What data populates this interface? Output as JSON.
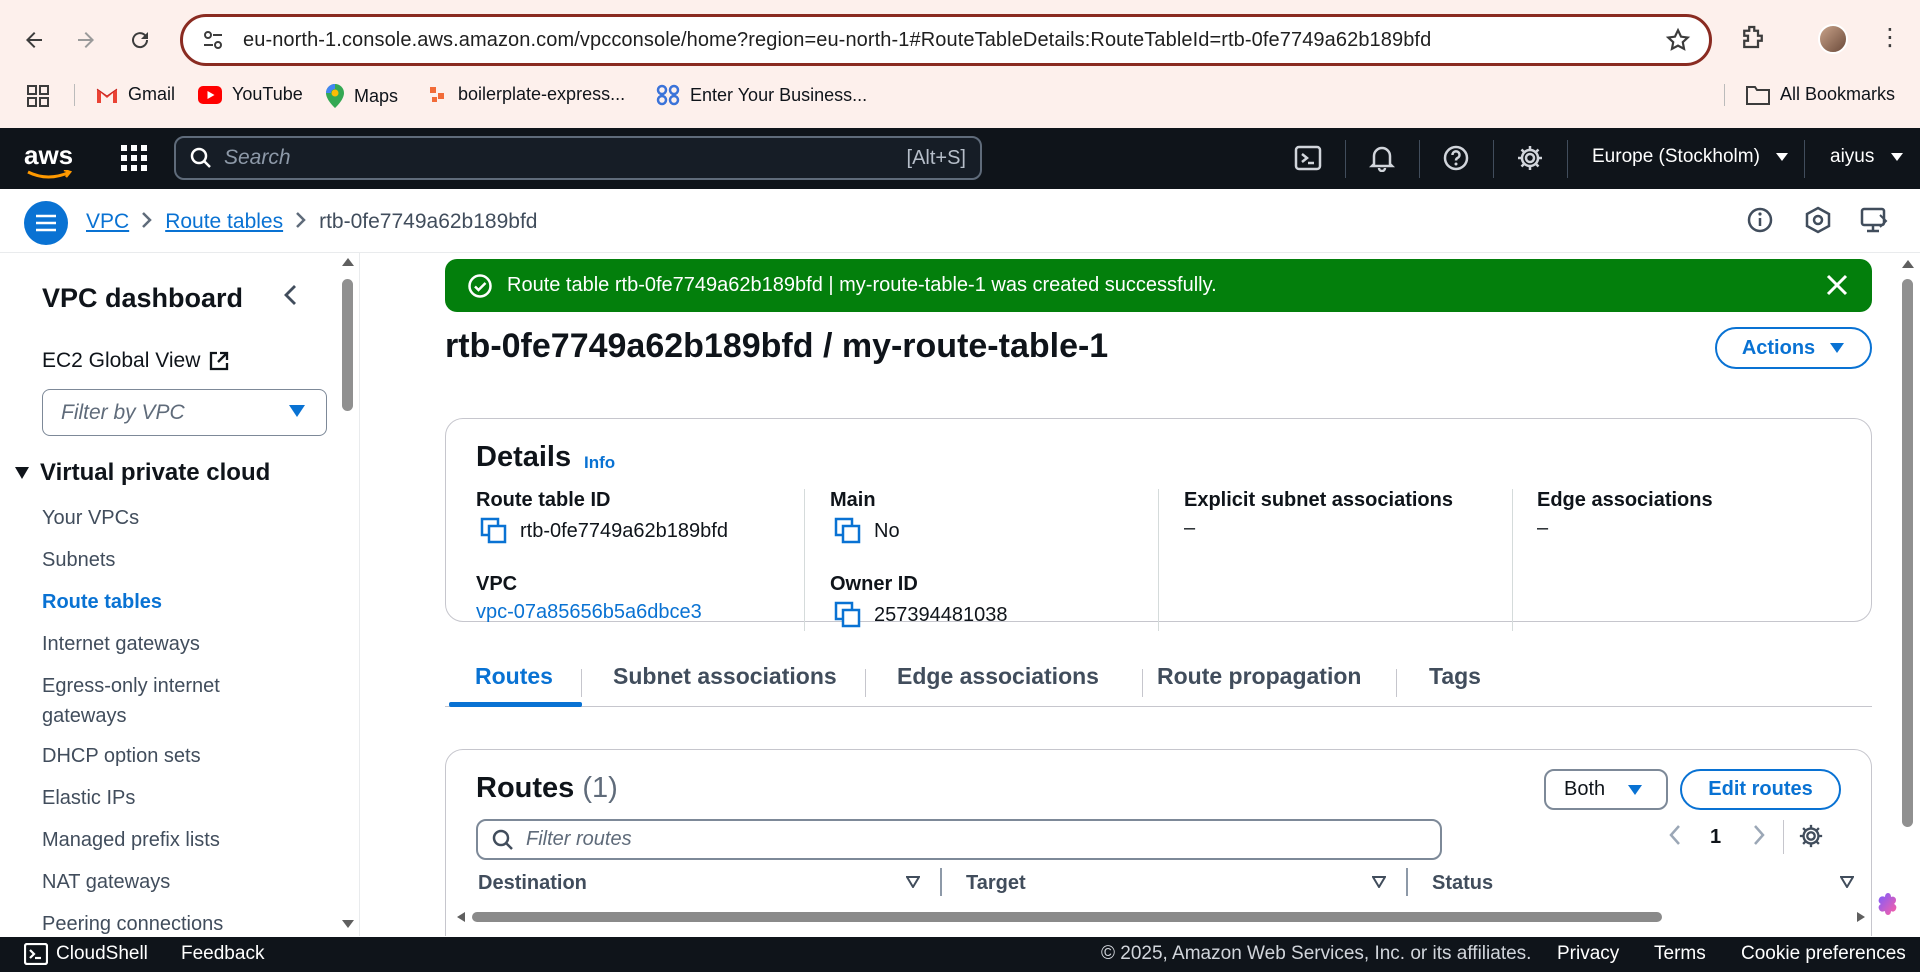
{
  "browser": {
    "url": "eu-north-1.console.aws.amazon.com/vpcconsole/home?region=eu-north-1#RouteTableDetails:RouteTableId=rtb-0fe7749a62b189bfd",
    "bookmarks": [
      "Gmail",
      "YouTube",
      "Maps",
      "boilerplate-express...",
      "Enter Your Business..."
    ],
    "all_bookmarks": "All Bookmarks"
  },
  "aws_nav": {
    "logo": "aws",
    "search_placeholder": "Search",
    "search_shortcut": "[Alt+S]",
    "region": "Europe (Stockholm)",
    "user": "aiyus"
  },
  "breadcrumb": {
    "items": [
      "VPC",
      "Route tables"
    ],
    "current": "rtb-0fe7749a62b189bfd"
  },
  "sidebar": {
    "title": "VPC dashboard",
    "ec2_global_view": "EC2 Global View",
    "filter_placeholder": "Filter by VPC",
    "section": "Virtual private cloud",
    "items": [
      "Your VPCs",
      "Subnets",
      "Route tables",
      "Internet gateways",
      "Egress-only internet gateways",
      "DHCP option sets",
      "Elastic IPs",
      "Managed prefix lists",
      "NAT gateways",
      "Peering connections"
    ],
    "active_item": "Route tables"
  },
  "flash": {
    "message": "Route table rtb-0fe7749a62b189bfd | my-route-table-1 was created successfully."
  },
  "page": {
    "title": "rtb-0fe7749a62b189bfd / my-route-table-1",
    "actions_label": "Actions"
  },
  "details": {
    "heading": "Details",
    "info": "Info",
    "route_table_id_label": "Route table ID",
    "route_table_id": "rtb-0fe7749a62b189bfd",
    "vpc_label": "VPC",
    "vpc": "vpc-07a85656b5a6dbce3",
    "main_label": "Main",
    "main": "No",
    "owner_id_label": "Owner ID",
    "owner_id": "257394481038",
    "explicit_label": "Explicit subnet associations",
    "explicit": "–",
    "edge_label": "Edge associations",
    "edge": "–"
  },
  "tabs": [
    "Routes",
    "Subnet associations",
    "Edge associations",
    "Route propagation",
    "Tags"
  ],
  "routes": {
    "heading": "Routes",
    "count": "(1)",
    "both_label": "Both",
    "edit_label": "Edit routes",
    "filter_placeholder": "Filter routes",
    "page": "1",
    "columns": [
      "Destination",
      "Target",
      "Status"
    ]
  },
  "footer": {
    "cloudshell": "CloudShell",
    "feedback": "Feedback",
    "copyright": "© 2025, Amazon Web Services, Inc. or its affiliates.",
    "privacy": "Privacy",
    "terms": "Terms",
    "cookies": "Cookie preferences"
  },
  "colors": {
    "primary": "#0972d3",
    "success": "#037f0c",
    "nav_bg": "#0f141a"
  }
}
